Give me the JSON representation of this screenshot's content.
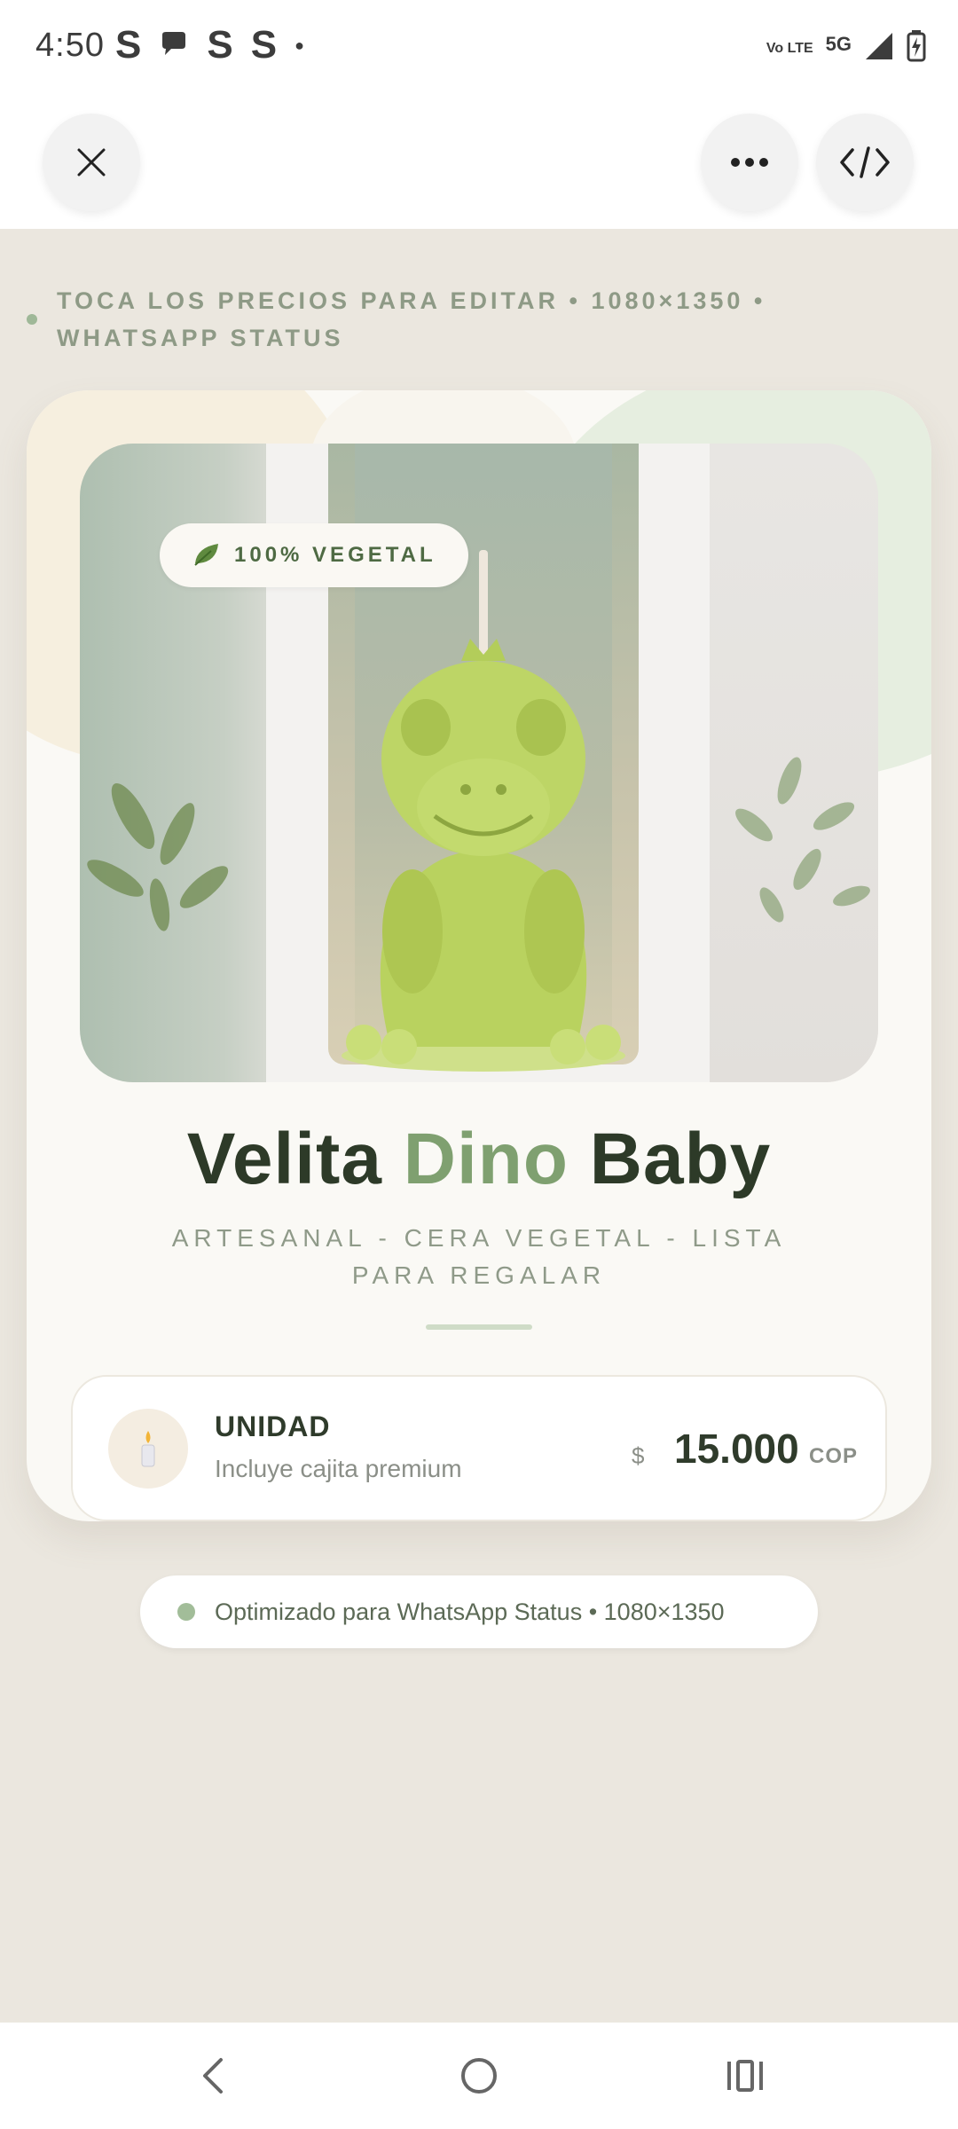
{
  "status_bar": {
    "time": "4:50",
    "notifications": [
      "S",
      "S",
      "S"
    ],
    "network": "5G",
    "volte": "Vo LTE"
  },
  "toolbar": {
    "close_icon": "close-icon",
    "more_icon": "more-horizontal-icon",
    "code_icon": "code-icon"
  },
  "hint": {
    "text": "TOCA LOS PRECIOS PARA EDITAR • 1080×1350 • WHATSAPP STATUS"
  },
  "card": {
    "badge": "100% VEGETAL",
    "title_part1": "Velita",
    "title_accent": "Dino",
    "title_part2": "Baby",
    "subtitle": "ARTESANAL - CERA VEGETAL - LISTA PARA REGALAR",
    "price": {
      "label": "UNIDAD",
      "description": "Incluye cajita premium",
      "symbol": "$",
      "value": "15.000",
      "currency": "COP"
    }
  },
  "footer_pill": {
    "text": "Optimizado para WhatsApp Status • 1080×1350"
  },
  "colors": {
    "background": "#ebe7df",
    "accent_green": "#7fa070",
    "dark_text": "#2d3a28",
    "card": "#faf9f5"
  }
}
